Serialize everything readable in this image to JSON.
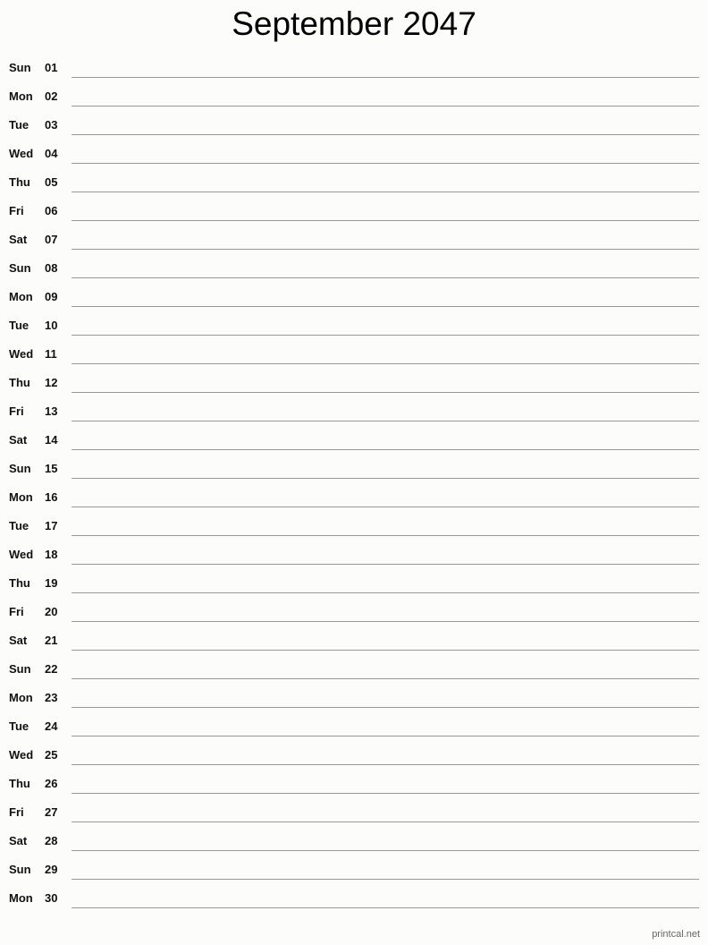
{
  "title": "September 2047",
  "footer": "printcal.net",
  "days": [
    {
      "dow": "Sun",
      "num": "01"
    },
    {
      "dow": "Mon",
      "num": "02"
    },
    {
      "dow": "Tue",
      "num": "03"
    },
    {
      "dow": "Wed",
      "num": "04"
    },
    {
      "dow": "Thu",
      "num": "05"
    },
    {
      "dow": "Fri",
      "num": "06"
    },
    {
      "dow": "Sat",
      "num": "07"
    },
    {
      "dow": "Sun",
      "num": "08"
    },
    {
      "dow": "Mon",
      "num": "09"
    },
    {
      "dow": "Tue",
      "num": "10"
    },
    {
      "dow": "Wed",
      "num": "11"
    },
    {
      "dow": "Thu",
      "num": "12"
    },
    {
      "dow": "Fri",
      "num": "13"
    },
    {
      "dow": "Sat",
      "num": "14"
    },
    {
      "dow": "Sun",
      "num": "15"
    },
    {
      "dow": "Mon",
      "num": "16"
    },
    {
      "dow": "Tue",
      "num": "17"
    },
    {
      "dow": "Wed",
      "num": "18"
    },
    {
      "dow": "Thu",
      "num": "19"
    },
    {
      "dow": "Fri",
      "num": "20"
    },
    {
      "dow": "Sat",
      "num": "21"
    },
    {
      "dow": "Sun",
      "num": "22"
    },
    {
      "dow": "Mon",
      "num": "23"
    },
    {
      "dow": "Tue",
      "num": "24"
    },
    {
      "dow": "Wed",
      "num": "25"
    },
    {
      "dow": "Thu",
      "num": "26"
    },
    {
      "dow": "Fri",
      "num": "27"
    },
    {
      "dow": "Sat",
      "num": "28"
    },
    {
      "dow": "Sun",
      "num": "29"
    },
    {
      "dow": "Mon",
      "num": "30"
    }
  ]
}
